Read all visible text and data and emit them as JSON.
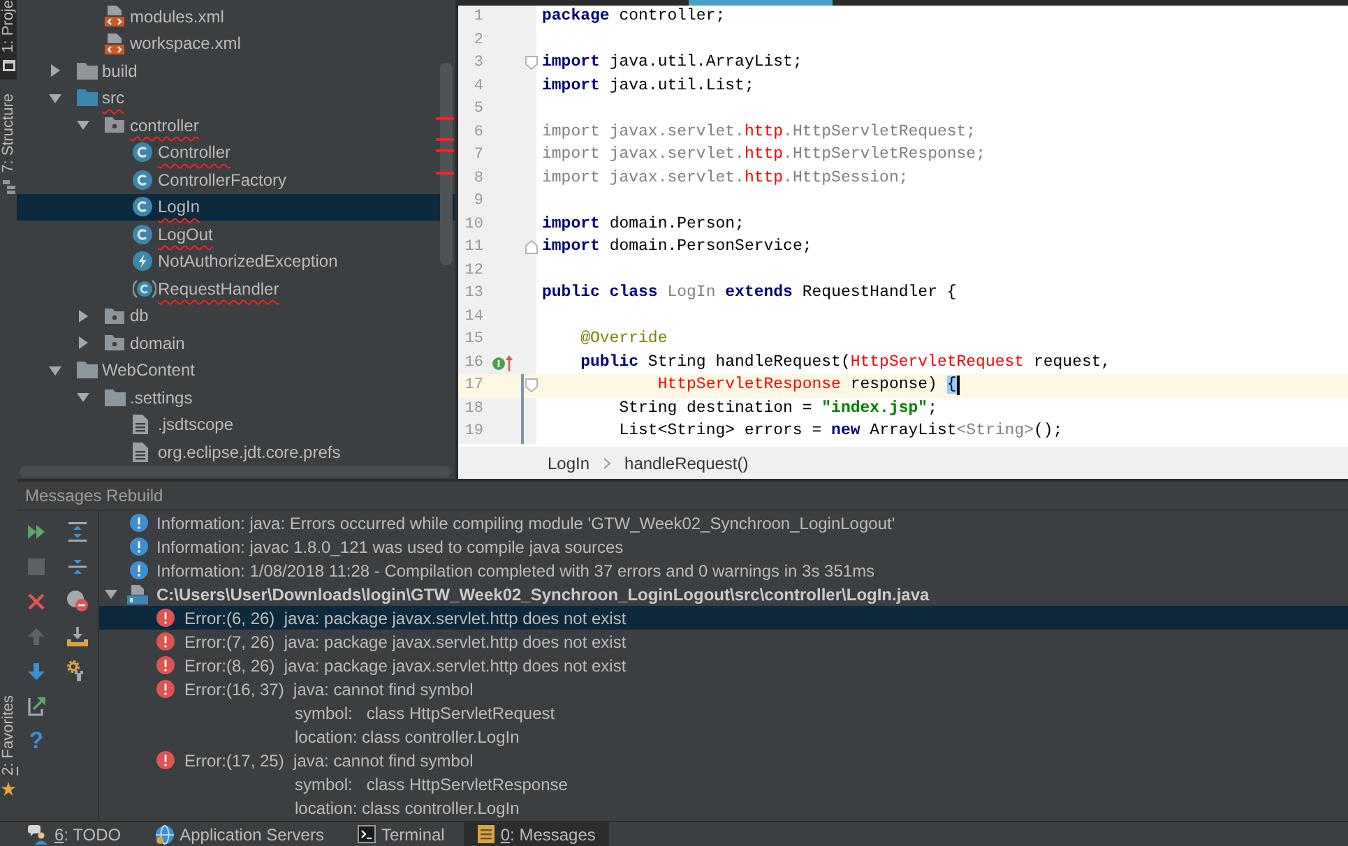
{
  "side_strip": {
    "top": [
      {
        "key": "1",
        "label": ": Proje",
        "kind": "project",
        "selected": true
      },
      {
        "key": "7",
        "label": ": Structure",
        "kind": "structure",
        "selected": false
      }
    ],
    "bottom": [
      {
        "key": "2",
        "label": ": Favorites",
        "kind": "favorites",
        "selected": false
      }
    ]
  },
  "project_tree": {
    "children": [
      {
        "children": [
          {
            "name": "modules.xml",
            "kind": "xml",
            "selected": false,
            "error": false
          },
          {
            "name": "workspace.xml",
            "kind": "xml",
            "selected": false,
            "error": false
          }
        ]
      },
      {
        "name": "build",
        "kind": "folder",
        "expanded": false,
        "selected": false,
        "error": false
      },
      {
        "name": "src",
        "kind": "source-folder",
        "expanded": true,
        "selected": false,
        "error": true,
        "children": [
          {
            "name": "controller",
            "kind": "package",
            "expanded": true,
            "selected": false,
            "error": true,
            "children": [
              {
                "name": "Controller",
                "kind": "class",
                "selected": false,
                "error": true
              },
              {
                "name": "ControllerFactory",
                "kind": "class",
                "selected": false,
                "error": false
              },
              {
                "name": "LogIn",
                "kind": "class",
                "selected": true,
                "error": true
              },
              {
                "name": "LogOut",
                "kind": "class",
                "selected": false,
                "error": true
              },
              {
                "name": "NotAuthorizedException",
                "kind": "exception",
                "selected": false,
                "error": false
              },
              {
                "name": "RequestHandler",
                "kind": "abstract-class",
                "selected": false,
                "error": true
              }
            ]
          },
          {
            "name": "db",
            "kind": "package",
            "expanded": false,
            "selected": false,
            "error": false
          },
          {
            "name": "domain",
            "kind": "package",
            "expanded": false,
            "selected": false,
            "error": false
          }
        ]
      },
      {
        "name": "WebContent",
        "kind": "folder",
        "expanded": true,
        "selected": false,
        "error": false,
        "children": [
          {
            "name": ".settings",
            "kind": "folder",
            "expanded": true,
            "selected": false,
            "error": false,
            "children": [
              {
                "name": ".jsdtscope",
                "kind": "file",
                "selected": false,
                "error": false
              },
              {
                "name": "org.eclipse.jdt.core.prefs",
                "kind": "file",
                "selected": false,
                "error": false
              }
            ]
          }
        ]
      }
    ]
  },
  "editor": {
    "lines": [
      {
        "number": "1",
        "tokens": [
          {
            "text": "package",
            "kind": "keyword"
          },
          {
            "text": " controller;",
            "kind": "plain"
          }
        ]
      },
      {
        "number": "2"
      },
      {
        "number": "3",
        "fold_start": true,
        "tokens": [
          {
            "text": "import",
            "kind": "keyword"
          },
          {
            "text": " java.util.ArrayList;",
            "kind": "plain"
          }
        ]
      },
      {
        "number": "4",
        "tokens": [
          {
            "text": "import",
            "kind": "keyword"
          },
          {
            "text": " java.util.List;",
            "kind": "plain"
          }
        ]
      },
      {
        "number": "5"
      },
      {
        "number": "6",
        "tokens": [
          {
            "text": "import javax.servlet.",
            "kind": "unused"
          },
          {
            "text": "http",
            "kind": "error"
          },
          {
            "text": ".HttpServletRequest;",
            "kind": "unused"
          }
        ]
      },
      {
        "number": "7",
        "tokens": [
          {
            "text": "import javax.servlet.",
            "kind": "unused"
          },
          {
            "text": "http",
            "kind": "error"
          },
          {
            "text": ".HttpServletResponse;",
            "kind": "unused"
          }
        ]
      },
      {
        "number": "8",
        "tokens": [
          {
            "text": "import javax.servlet.",
            "kind": "unused"
          },
          {
            "text": "http",
            "kind": "error"
          },
          {
            "text": ".HttpSession;",
            "kind": "unused"
          }
        ]
      },
      {
        "number": "9"
      },
      {
        "number": "10",
        "tokens": [
          {
            "text": "import",
            "kind": "keyword"
          },
          {
            "text": " domain.Person;",
            "kind": "plain"
          }
        ]
      },
      {
        "number": "11",
        "fold_end": true,
        "tokens": [
          {
            "text": "import",
            "kind": "keyword"
          },
          {
            "text": " domain.PersonService;",
            "kind": "plain"
          }
        ]
      },
      {
        "number": "12"
      },
      {
        "number": "13",
        "tokens": [
          {
            "text": "public class ",
            "kind": "keyword"
          },
          {
            "text": "LogIn",
            "kind": "unused"
          },
          {
            "text": " extends ",
            "kind": "keyword"
          },
          {
            "text": "RequestHandler {",
            "kind": "plain"
          }
        ]
      },
      {
        "number": "14"
      },
      {
        "number": "15",
        "tokens": [
          {
            "text": "    @Override",
            "kind": "annotation"
          }
        ]
      },
      {
        "number": "16",
        "override_marker": true,
        "tokens": [
          {
            "text": "    public",
            "kind": "keyword"
          },
          {
            "text": " String handleRequest(",
            "kind": "plain"
          },
          {
            "text": "HttpServletRequest",
            "kind": "error"
          },
          {
            "text": " request,",
            "kind": "plain"
          }
        ]
      },
      {
        "number": "17",
        "current": true,
        "changed": true,
        "fold_start": true,
        "tokens": [
          {
            "text": "            HttpServletResponse",
            "kind": "error"
          },
          {
            "text": " response) ",
            "kind": "plain"
          },
          {
            "text": "{",
            "kind": "brace-match"
          }
        ]
      },
      {
        "number": "18",
        "changed": true,
        "tokens": [
          {
            "text": "        String destination = ",
            "kind": "plain"
          },
          {
            "text": "\"index.jsp\"",
            "kind": "string"
          },
          {
            "text": ";",
            "kind": "plain"
          }
        ]
      },
      {
        "number": "19",
        "changed": true,
        "tokens": [
          {
            "text": "        List<String> errors = ",
            "kind": "plain"
          },
          {
            "text": "new",
            "kind": "keyword"
          },
          {
            "text": " ArrayList",
            "kind": "plain"
          },
          {
            "text": "<String>",
            "kind": "unused"
          },
          {
            "text": "();",
            "kind": "plain"
          }
        ]
      }
    ],
    "breadcrumbs": [
      "LogIn",
      "handleRequest()"
    ]
  },
  "messages": {
    "title": "Messages Rebuild",
    "toolbar": {
      "help": "?"
    },
    "items": [
      {
        "kind": "info",
        "selected": false,
        "text": "Information: java: Errors occurred while compiling module 'GTW_Week02_Synchroon_LoginLogout'"
      },
      {
        "kind": "info",
        "selected": false,
        "text": "Information: javac 1.8.0_121 was used to compile java sources"
      },
      {
        "kind": "info",
        "selected": false,
        "text": "Information: 1/08/2018 11:28 - Compilation completed with 37 errors and 0 warnings in 3s 351ms"
      },
      {
        "kind": "file",
        "selected": false,
        "expanded": true,
        "text": "C:\\Users\\User\\Downloads\\login\\GTW_Week02_Synchroon_LoginLogout\\src\\controller\\LogIn.java",
        "children": [
          {
            "kind": "error",
            "selected": true,
            "text": "Error:(6, 26)  java: package javax.servlet.http does not exist"
          },
          {
            "kind": "error",
            "selected": false,
            "text": "Error:(7, 26)  java: package javax.servlet.http does not exist"
          },
          {
            "kind": "error",
            "selected": false,
            "text": "Error:(8, 26)  java: package javax.servlet.http does not exist"
          },
          {
            "kind": "error",
            "selected": false,
            "text": "Error:(16, 37)  java: cannot find symbol",
            "details": [
              "symbol:   class HttpServletRequest",
              "location: class controller.LogIn"
            ]
          },
          {
            "kind": "error",
            "selected": false,
            "text": "Error:(17, 25)  java: cannot find symbol",
            "details": [
              "symbol:   class HttpServletResponse",
              "location: class controller.LogIn"
            ]
          }
        ]
      }
    ]
  },
  "tool_windows": [
    {
      "key": "6",
      "label": ": TODO",
      "kind": "todo",
      "selected": false
    },
    {
      "label": "Application Servers",
      "kind": "servers",
      "selected": false
    },
    {
      "label": "Terminal",
      "kind": "terminal",
      "selected": false
    },
    {
      "key": "0",
      "label": ": Messages",
      "kind": "messages",
      "selected": true
    }
  ]
}
